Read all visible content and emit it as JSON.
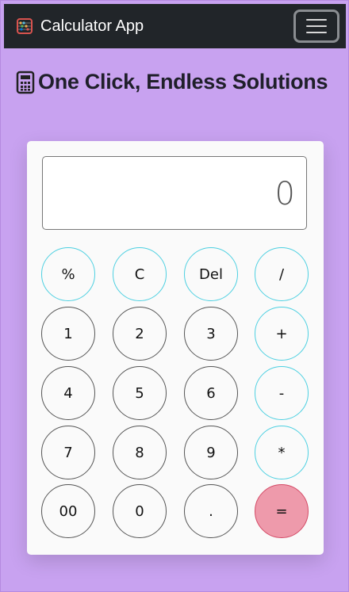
{
  "navbar": {
    "brand": "Calculator App",
    "brand_icon": "abacus-icon",
    "menu_icon": "hamburger-menu-icon",
    "background": "#212529"
  },
  "headline": {
    "icon": "calculator-icon",
    "text": "One Click, Endless Solutions"
  },
  "display": {
    "value": "0"
  },
  "keypad": {
    "rows": [
      [
        {
          "label": "%",
          "kind": "op"
        },
        {
          "label": "C",
          "kind": "op"
        },
        {
          "label": "Del",
          "kind": "op"
        },
        {
          "label": "/",
          "kind": "op"
        }
      ],
      [
        {
          "label": "1",
          "kind": "num"
        },
        {
          "label": "2",
          "kind": "num"
        },
        {
          "label": "3",
          "kind": "num"
        },
        {
          "label": "+",
          "kind": "op"
        }
      ],
      [
        {
          "label": "4",
          "kind": "num"
        },
        {
          "label": "5",
          "kind": "num"
        },
        {
          "label": "6",
          "kind": "num"
        },
        {
          "label": "-",
          "kind": "op"
        }
      ],
      [
        {
          "label": "7",
          "kind": "num"
        },
        {
          "label": "8",
          "kind": "num"
        },
        {
          "label": "9",
          "kind": "num"
        },
        {
          "label": "*",
          "kind": "op"
        }
      ],
      [
        {
          "label": "00",
          "kind": "num"
        },
        {
          "label": "0",
          "kind": "num"
        },
        {
          "label": ".",
          "kind": "num"
        },
        {
          "label": "=",
          "kind": "eq"
        }
      ]
    ]
  },
  "colors": {
    "page_background": "#c8a2f0",
    "operator_border": "#4dd0e1",
    "equals_fill": "#ee9aab"
  }
}
